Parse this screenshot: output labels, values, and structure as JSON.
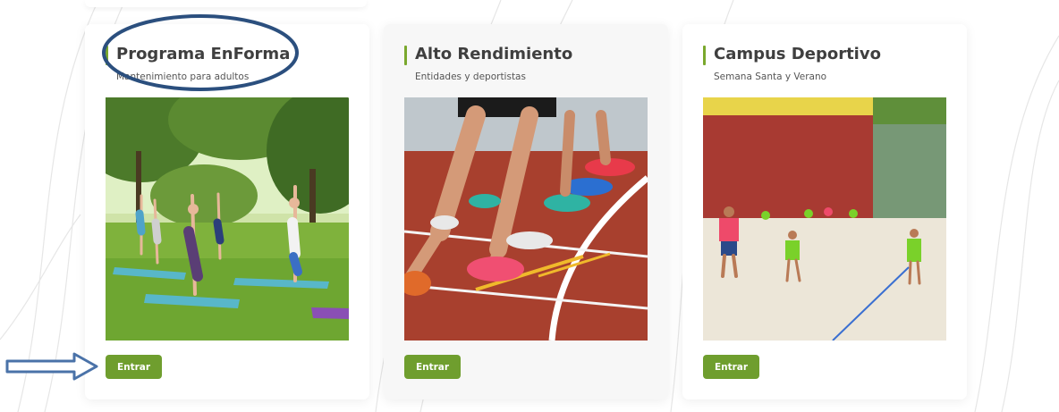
{
  "cards": [
    {
      "title": "Programa EnForma",
      "subtitle": "Mantenimiento para adultos",
      "button_label": "Entrar",
      "image_scene": "outdoor-yoga-group-in-park"
    },
    {
      "title": "Alto Rendimiento",
      "subtitle": "Entidades y deportistas",
      "button_label": "Entrar",
      "image_scene": "runners-legs-on-athletics-track"
    },
    {
      "title": "Campus Deportivo",
      "subtitle": "Semana Santa y Verano",
      "button_label": "Entrar",
      "image_scene": "kids-playing-on-sand-court"
    }
  ],
  "colors": {
    "accent": "#7aa82d",
    "button": "#6f9e2e",
    "annotation_ellipse": "#2b4f7e",
    "annotation_arrow": "#4a72a8"
  }
}
